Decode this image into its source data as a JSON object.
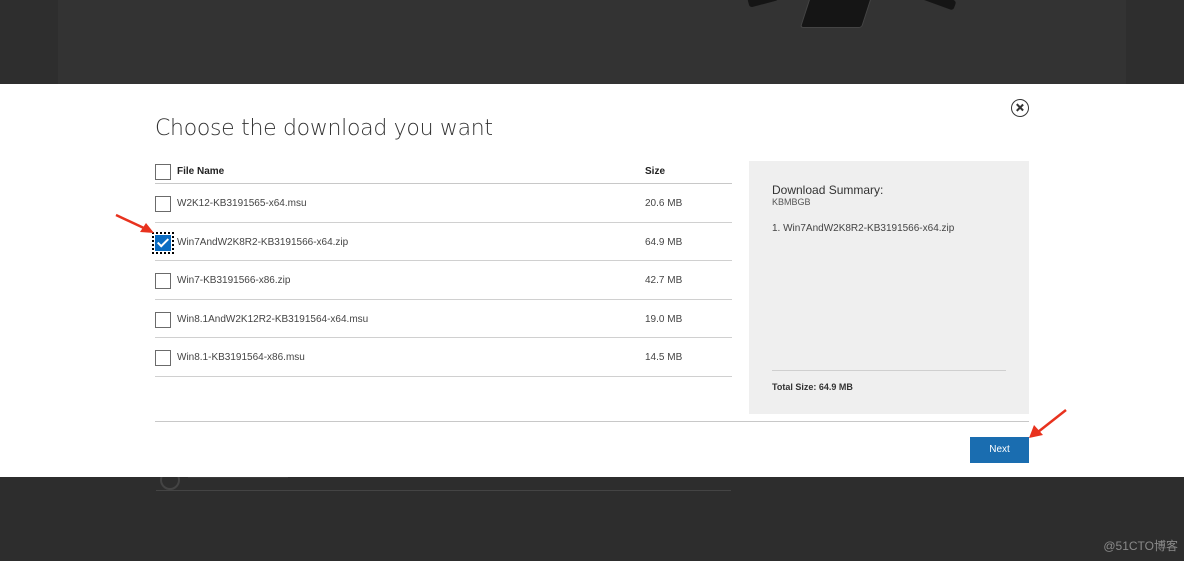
{
  "modal": {
    "title": "Choose the download you want",
    "close_icon": "close-circle-icon"
  },
  "table": {
    "headers": {
      "file_name": "File Name",
      "size": "Size"
    },
    "rows": [
      {
        "name": "W2K12-KB3191565-x64.msu",
        "size": "20.6 MB",
        "checked": false
      },
      {
        "name": "Win7AndW2K8R2-KB3191566-x64.zip",
        "size": "64.9 MB",
        "checked": true
      },
      {
        "name": "Win7-KB3191566-x86.zip",
        "size": "42.7 MB",
        "checked": false
      },
      {
        "name": "Win8.1AndW2K12R2-KB3191564-x64.msu",
        "size": "19.0 MB",
        "checked": false
      },
      {
        "name": "Win8.1-KB3191564-x86.msu",
        "size": "14.5 MB",
        "checked": false
      }
    ]
  },
  "summary": {
    "title": "Download Summary:",
    "kb": "KBMBGB",
    "items": [
      "1. Win7AndW2K8R2-KB3191566-x64.zip"
    ],
    "total": "Total Size: 64.9 MB"
  },
  "footer": {
    "next_label": "Next"
  },
  "watermark": "@51CTO博客",
  "colors": {
    "accent": "#1a6db0",
    "annotation_arrow": "#e8321e"
  }
}
